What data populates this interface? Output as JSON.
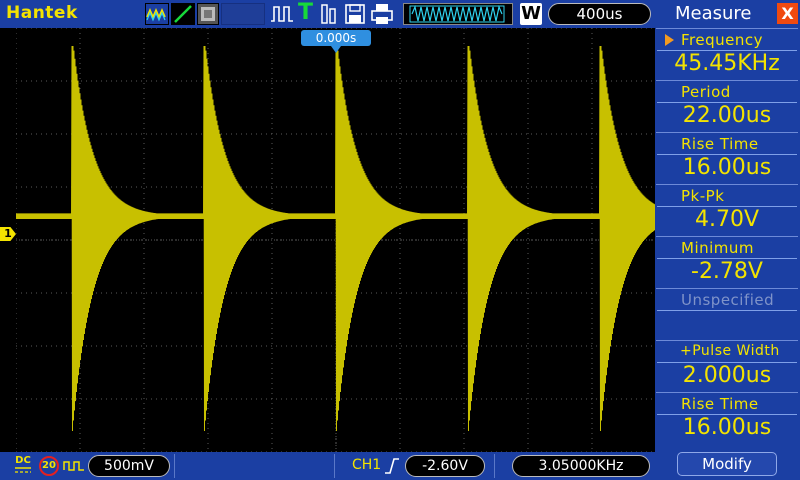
{
  "app": {
    "brand": "Hantek"
  },
  "toolbar": {
    "icons": [
      "waveform-icon",
      "slope-icon",
      "persistence-icon",
      "pulse-icon",
      "trigger-t-icon",
      "cursor-icon",
      "save-icon",
      "print-icon",
      "memory-depth-icon"
    ],
    "window_label": "W",
    "timebase": "400us"
  },
  "plot": {
    "trigger_time": "0.000s",
    "channel_marker": "1",
    "trace_color": "#c8c000",
    "grid_color": "#5a5a5a"
  },
  "status_bar": {
    "coupling": "DC",
    "bandwidth_limit": "20",
    "volts_div": "500mV",
    "trigger_source": "CH1",
    "trigger_level": "-2.60V",
    "frequency": "3.05000KHz"
  },
  "measure_panel": {
    "title": "Measure",
    "close_label": "X",
    "slots": [
      {
        "label": "Frequency",
        "value": "45.45KHz",
        "selected": true
      },
      {
        "label": "Period",
        "value": "22.00us"
      },
      {
        "label": "Rise Time",
        "value": "16.00us"
      },
      {
        "label": "Pk-Pk",
        "value": "4.70V"
      },
      {
        "label": "Minimum",
        "value": "-2.78V"
      },
      {
        "label": "Unspecified",
        "value": ""
      },
      {
        "label": "+Pulse Width",
        "value": "2.000us"
      },
      {
        "label": "Rise Time",
        "value": "16.00us"
      }
    ],
    "modify_label": "Modify"
  },
  "colors": {
    "bar_blue": "#1b3fa3",
    "yellow": "#f3e300",
    "accent_blue": "#2f8fe0"
  }
}
